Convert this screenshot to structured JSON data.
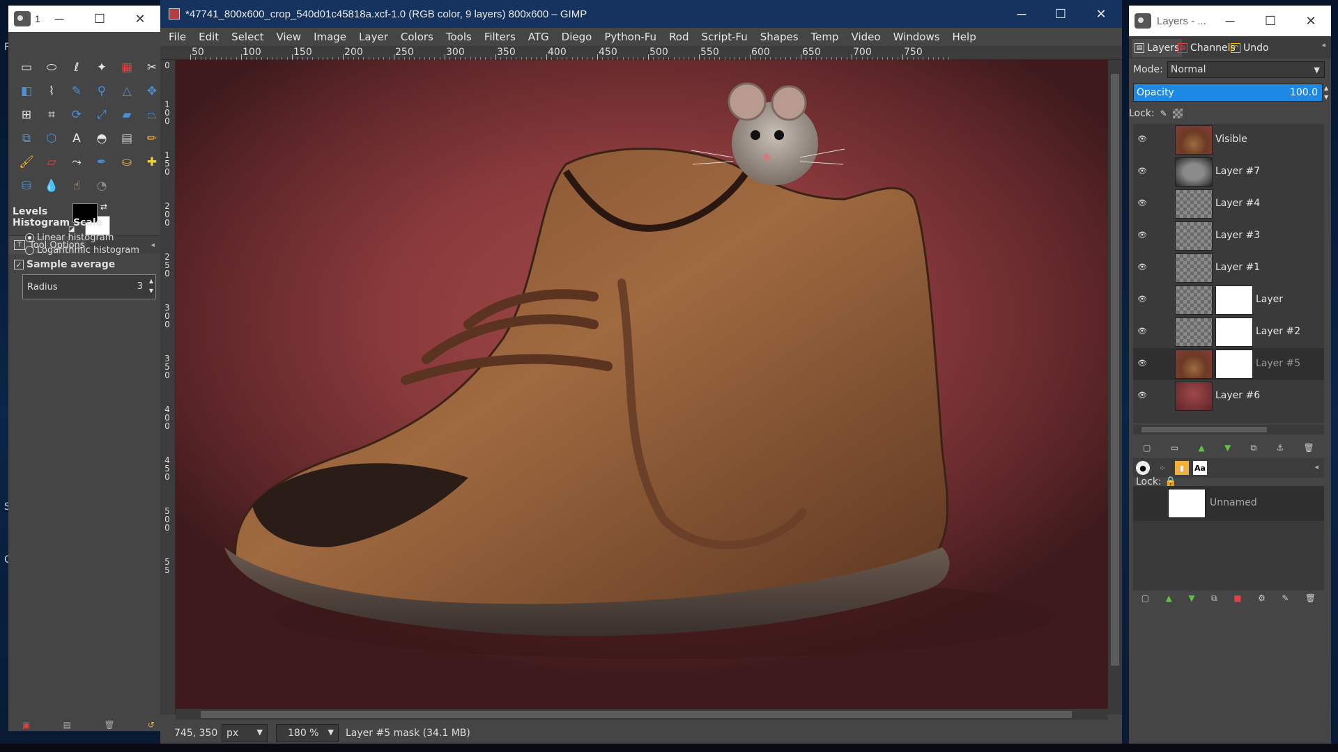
{
  "toolbox": {
    "title": "1",
    "tools": [
      {
        "name": "rect-select-icon",
        "glyph": "▭",
        "color": "#e8e8e8"
      },
      {
        "name": "ellipse-select-icon",
        "glyph": "⬭",
        "color": "#e8e8e8"
      },
      {
        "name": "free-select-icon",
        "glyph": "ℓ",
        "color": "#e8e8e8"
      },
      {
        "name": "fuzzy-select-icon",
        "glyph": "✦",
        "color": "#e8e8e8"
      },
      {
        "name": "select-by-color-icon",
        "glyph": "▦",
        "color": "#e84040"
      },
      {
        "name": "scissors-select-icon",
        "glyph": "✂",
        "color": "#e8e8e8"
      },
      {
        "name": "foreground-select-icon",
        "glyph": "◧",
        "color": "#4a90d9"
      },
      {
        "name": "paths-icon",
        "glyph": "⌇",
        "color": "#e8e8e8"
      },
      {
        "name": "color-picker-icon",
        "glyph": "✎",
        "color": "#4a90d9"
      },
      {
        "name": "zoom-icon",
        "glyph": "⚲",
        "color": "#4a90d9"
      },
      {
        "name": "measure-icon",
        "glyph": "△",
        "color": "#4a90d9"
      },
      {
        "name": "move-icon",
        "glyph": "✥",
        "color": "#4a90d9"
      },
      {
        "name": "align-icon",
        "glyph": "⊞",
        "color": "#e8e8e8"
      },
      {
        "name": "crop-icon",
        "glyph": "⌗",
        "color": "#e8e8e8"
      },
      {
        "name": "rotate-icon",
        "glyph": "⟳",
        "color": "#4a90d9"
      },
      {
        "name": "scale-icon",
        "glyph": "⤢",
        "color": "#4a90d9"
      },
      {
        "name": "shear-icon",
        "glyph": "▰",
        "color": "#4a90d9"
      },
      {
        "name": "perspective-icon",
        "glyph": "⏢",
        "color": "#4a90d9"
      },
      {
        "name": "unified-transform-icon",
        "glyph": "⧉",
        "color": "#4a90d9"
      },
      {
        "name": "cage-transform-icon",
        "glyph": "⬡",
        "color": "#4a90d9"
      },
      {
        "name": "text-icon",
        "glyph": "A",
        "color": "#e8e8e8"
      },
      {
        "name": "bucket-fill-icon",
        "glyph": "◓",
        "color": "#e8e8e8"
      },
      {
        "name": "gradient-icon",
        "glyph": "▤",
        "color": "#d0d0d0"
      },
      {
        "name": "pencil-icon",
        "glyph": "✏",
        "color": "#f0b040"
      },
      {
        "name": "paintbrush-icon",
        "glyph": "🖌",
        "color": "#f0b040"
      },
      {
        "name": "eraser-icon",
        "glyph": "▱",
        "color": "#e84040"
      },
      {
        "name": "airbrush-icon",
        "glyph": "⤳",
        "color": "#e8e8e8"
      },
      {
        "name": "ink-icon",
        "glyph": "✒",
        "color": "#4a90d9"
      },
      {
        "name": "clone-icon",
        "glyph": "⛀",
        "color": "#f0b040"
      },
      {
        "name": "heal-icon",
        "glyph": "✚",
        "color": "#f0d040"
      },
      {
        "name": "perspective-clone-icon",
        "glyph": "⛁",
        "color": "#4a90d9"
      },
      {
        "name": "blur-icon",
        "glyph": "💧",
        "color": "#4a90d9"
      },
      {
        "name": "smudge-icon",
        "glyph": "☝",
        "color": "#f0b040"
      },
      {
        "name": "dodge-burn-icon",
        "glyph": "◔",
        "color": "#888888"
      }
    ],
    "tool_options_tab": "Tool Options",
    "tool_name": "Levels",
    "histogram_scale_label": "Histogram Scale",
    "linear_label": "Linear histogram",
    "log_label": "Logarithmic histogram",
    "sample_average_label": "Sample average",
    "radius_label": "Radius",
    "radius_value": "3",
    "fg_color": "#000000",
    "bg_color": "#ffffff"
  },
  "main": {
    "title": "*47741_800x600_crop_540d01c45818a.xcf-1.0 (RGB color, 9 layers) 800x600 – GIMP",
    "menus": [
      "File",
      "Edit",
      "Select",
      "View",
      "Image",
      "Layer",
      "Colors",
      "Tools",
      "Filters",
      "ATG",
      "Diego",
      "Python-Fu",
      "Rod",
      "Script-Fu",
      "Shapes",
      "Temp",
      "Video",
      "Windows",
      "Help"
    ],
    "ruler_labels": [
      "50",
      "100",
      "150",
      "200",
      "250",
      "300",
      "350",
      "400",
      "450",
      "500",
      "550",
      "600",
      "650",
      "700",
      "750"
    ],
    "vruler_labels": [
      "0",
      "1\n0\n0",
      "1\n5\n0",
      "2\n0\n0",
      "2\n5\n0",
      "3\n0\n0",
      "3\n5\n0",
      "4\n0\n0",
      "4\n5\n0",
      "5\n0\n0",
      "5\n5"
    ],
    "status": {
      "coords": "745, 350",
      "unit": "px",
      "zoom": "180 %",
      "message": "Layer #5 mask (34.1 MB)"
    }
  },
  "layers_dock": {
    "title": "Layers - ...",
    "tabs": [
      "Layers",
      "Channels",
      "Undo"
    ],
    "mode_label": "Mode:",
    "mode_value": "Normal",
    "opacity_label": "Opacity",
    "opacity_value": "100.0",
    "opacity_fraction": 1.0,
    "lock_label": "Lock:",
    "layers": [
      {
        "name": "Visible",
        "has_mask": false,
        "thumb": "shoe"
      },
      {
        "name": "Layer #7",
        "has_mask": false,
        "thumb": "vignette"
      },
      {
        "name": "Layer #4",
        "has_mask": false,
        "thumb": "checker"
      },
      {
        "name": "Layer #3",
        "has_mask": false,
        "thumb": "checker"
      },
      {
        "name": "Layer #1",
        "has_mask": false,
        "thumb": "checker"
      },
      {
        "name": "Layer",
        "has_mask": true,
        "thumb": "checker"
      },
      {
        "name": "Layer #2",
        "has_mask": true,
        "thumb": "checker"
      },
      {
        "name": "Layer #5",
        "has_mask": true,
        "thumb": "shoe",
        "active": true
      },
      {
        "name": "Layer #6",
        "has_mask": false,
        "thumb": "red"
      }
    ],
    "lower_lock_label": "Lock:",
    "channel_name": "Unnamed"
  }
}
